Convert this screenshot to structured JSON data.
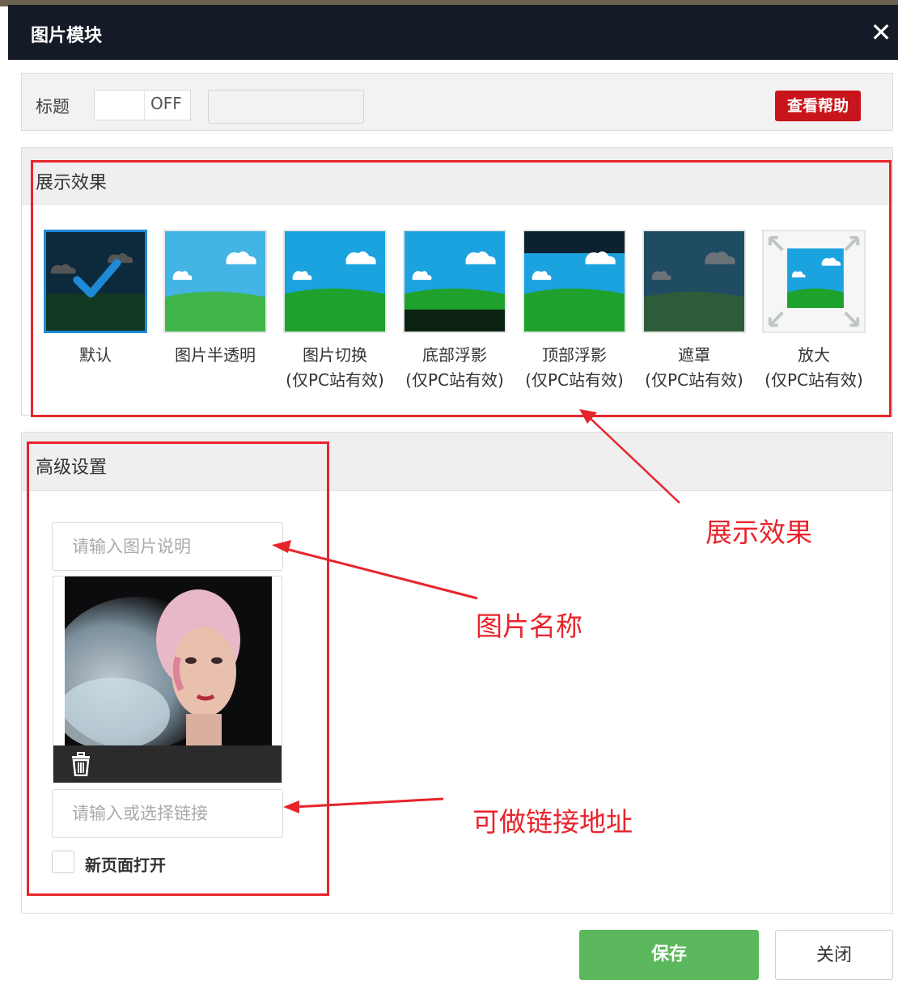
{
  "dialog": {
    "title": "图片模块",
    "close_glyph": "✕"
  },
  "title_row": {
    "label": "标题",
    "toggle_state": "OFF",
    "help_button": "查看帮助"
  },
  "display_effect": {
    "header": "展示效果",
    "options": [
      {
        "line1": "默认",
        "line2": "",
        "selected": true
      },
      {
        "line1": "图片半透明",
        "line2": "",
        "selected": false
      },
      {
        "line1": "图片切换",
        "line2": "(仅PC站有效)",
        "selected": false
      },
      {
        "line1": "底部浮影",
        "line2": "(仅PC站有效)",
        "selected": false
      },
      {
        "line1": "顶部浮影",
        "line2": "(仅PC站有效)",
        "selected": false
      },
      {
        "line1": "遮罩",
        "line2": "(仅PC站有效)",
        "selected": false
      },
      {
        "line1": "放大",
        "line2": "(仅PC站有效)",
        "selected": false
      }
    ]
  },
  "advanced": {
    "header": "高级设置",
    "desc_placeholder": "请输入图片说明",
    "link_placeholder": "请输入或选择链接",
    "new_page_label": "新页面打开",
    "new_page_checked": false
  },
  "footer": {
    "save_label": "保存",
    "close_label": "关闭"
  },
  "annotations": {
    "display_effect_note": "展示效果",
    "image_name_note": "图片名称",
    "link_note": "可做链接地址"
  },
  "colors": {
    "titlebar": "#141b26",
    "help_button": "#c8151b",
    "save_button": "#5cb85c",
    "selected_border": "#1e8ad6",
    "annotation_red": "#e8242b"
  }
}
